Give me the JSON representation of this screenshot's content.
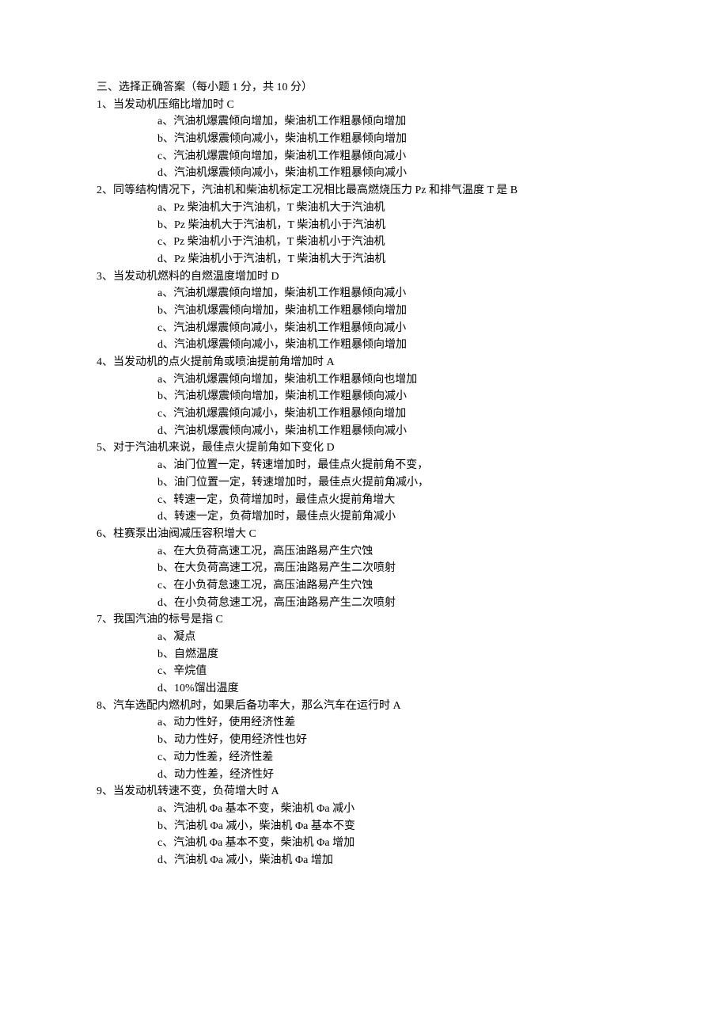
{
  "section_title": "三、选择正确答案（每小题 1 分，共 10 分）",
  "questions": [
    {
      "stem": "1、当发动机压缩比增加时  C",
      "options": [
        "a、汽油机爆震倾向增加，柴油机工作粗暴倾向增加",
        "b、汽油机爆震倾向减小，柴油机工作粗暴倾向增加",
        "c、汽油机爆震倾向增加，柴油机工作粗暴倾向减小",
        "d、汽油机爆震倾向减小，柴油机工作粗暴倾向减小"
      ]
    },
    {
      "stem": "2、同等结构情况下，汽油机和柴油机标定工况相比最高燃烧压力 Pz 和排气温度 T 是  B",
      "options": [
        "a、Pz 柴油机大于汽油机，T 柴油机大于汽油机",
        "b、Pz 柴油机大于汽油机，T 柴油机小于汽油机",
        "c、Pz 柴油机小于汽油机，T 柴油机小于汽油机",
        "d、Pz 柴油机小于汽油机，T 柴油机大于汽油机"
      ]
    },
    {
      "stem": "3、当发动机燃料的自燃温度增加时  D",
      "options": [
        "a、汽油机爆震倾向增加，柴油机工作粗暴倾向减小",
        "b、汽油机爆震倾向增加，柴油机工作粗暴倾向增加",
        "c、汽油机爆震倾向减小，柴油机工作粗暴倾向减小",
        "d、汽油机爆震倾向减小，柴油机工作粗暴倾向增加"
      ]
    },
    {
      "stem": "4、当发动机的点火提前角或喷油提前角增加时  A",
      "options": [
        "a、汽油机爆震倾向增加，柴油机工作粗暴倾向也增加",
        "b、汽油机爆震倾向增加，柴油机工作粗暴倾向减小",
        "c、汽油机爆震倾向减小，柴油机工作粗暴倾向增加",
        "d、汽油机爆震倾向减小，柴油机工作粗暴倾向减小"
      ]
    },
    {
      "stem": "5、对于汽油机来说，最佳点火提前角如下变化  D",
      "options": [
        "a、油门位置一定，转速增加时，最佳点火提前角不变，",
        "b、油门位置一定，转速增加时，最佳点火提前角减小，",
        "c、转速一定，负荷增加时，最佳点火提前角增大",
        "d、转速一定，负荷增加时，最佳点火提前角减小"
      ]
    },
    {
      "stem": "6、柱赛泵出油阀减压容积增大  C",
      "options": [
        "a、在大负荷高速工况，高压油路易产生穴蚀",
        "b、在大负荷高速工况，高压油路易产生二次喷射",
        "c、在小负荷怠速工况，高压油路易产生穴蚀",
        "d、在小负荷怠速工况，高压油路易产生二次喷射"
      ]
    },
    {
      "stem": "7、我国汽油的标号是指  C",
      "options": [
        "a、凝点",
        "b、自燃温度",
        "c、辛烷值",
        "d、10%馏出温度"
      ]
    },
    {
      "stem": "8、汽车选配内燃机时，如果后备功率大，那么汽车在运行时  A",
      "options": [
        "a、动力性好，使用经济性差",
        "b、动力性好，使用经济性也好",
        "c、动力性差，经济性差",
        "d、动力性差，经济性好"
      ]
    },
    {
      "stem": "9、当发动机转速不变，负荷增大时  A",
      "options": [
        "a、汽油机 Φa 基本不变，柴油机 Φa 减小",
        "b、汽油机 Φa 减小，柴油机 Φa 基本不变",
        "c、汽油机 Φa 基本不变，柴油机 Φa 增加",
        "d、汽油机 Φa 减小，柴油机 Φa 增加"
      ]
    }
  ]
}
